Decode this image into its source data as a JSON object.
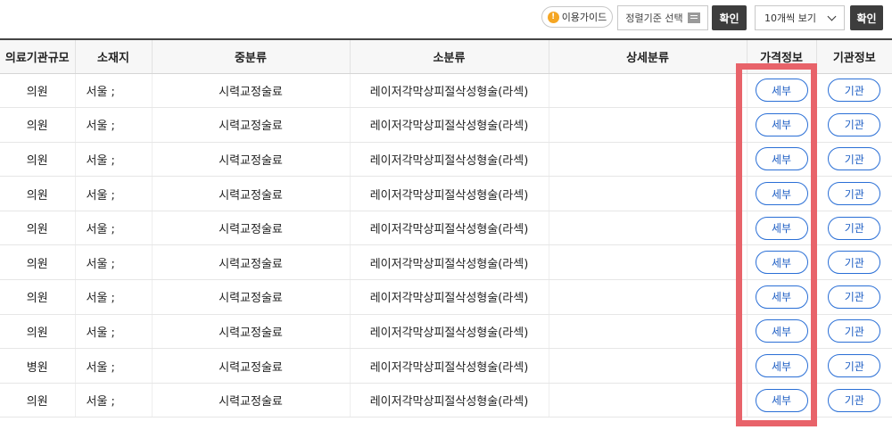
{
  "toolbar": {
    "guide_label": "이용가이드",
    "guide_icon": "exclamation-icon",
    "sort_label": "정렬기준 선택",
    "sort_icon": "list-icon",
    "confirm_label": "확인",
    "per_page_value": "10개씩 보기",
    "confirm2_label": "확인"
  },
  "table": {
    "headers": [
      "의료기관규모",
      "소재지",
      "중분류",
      "소분류",
      "상세분류",
      "가격정보",
      "기관정보"
    ],
    "rows": [
      {
        "size": "의원",
        "location": "서울 ;",
        "mid": "시력교정술료",
        "sub": "레이저각막상피절삭성형술(라섹)",
        "detail": "",
        "price_btn": "세부",
        "org_btn": "기관"
      },
      {
        "size": "의원",
        "location": "서울 ;",
        "mid": "시력교정술료",
        "sub": "레이저각막상피절삭성형술(라섹)",
        "detail": "",
        "price_btn": "세부",
        "org_btn": "기관"
      },
      {
        "size": "의원",
        "location": "서울 ;",
        "mid": "시력교정술료",
        "sub": "레이저각막상피절삭성형술(라섹)",
        "detail": "",
        "price_btn": "세부",
        "org_btn": "기관"
      },
      {
        "size": "의원",
        "location": "서울 ;",
        "mid": "시력교정술료",
        "sub": "레이저각막상피절삭성형술(라섹)",
        "detail": "",
        "price_btn": "세부",
        "org_btn": "기관"
      },
      {
        "size": "의원",
        "location": "서울 ;",
        "mid": "시력교정술료",
        "sub": "레이저각막상피절삭성형술(라섹)",
        "detail": "",
        "price_btn": "세부",
        "org_btn": "기관"
      },
      {
        "size": "의원",
        "location": "서울 ;",
        "mid": "시력교정술료",
        "sub": "레이저각막상피절삭성형술(라섹)",
        "detail": "",
        "price_btn": "세부",
        "org_btn": "기관"
      },
      {
        "size": "의원",
        "location": "서울 ;",
        "mid": "시력교정술료",
        "sub": "레이저각막상피절삭성형술(라섹)",
        "detail": "",
        "price_btn": "세부",
        "org_btn": "기관"
      },
      {
        "size": "의원",
        "location": "서울 ;",
        "mid": "시력교정술료",
        "sub": "레이저각막상피절삭성형술(라섹)",
        "detail": "",
        "price_btn": "세부",
        "org_btn": "기관"
      },
      {
        "size": "병원",
        "location": "서울 ;",
        "mid": "시력교정술료",
        "sub": "레이저각막상피절삭성형술(라섹)",
        "detail": "",
        "price_btn": "세부",
        "org_btn": "기관"
      },
      {
        "size": "의원",
        "location": "서울 ;",
        "mid": "시력교정술료",
        "sub": "레이저각막상피절삭성형술(라섹)",
        "detail": "",
        "price_btn": "세부",
        "org_btn": "기관"
      }
    ]
  },
  "colors": {
    "accent": "#2a6fd6",
    "highlight": "#e8636a",
    "dark_button": "#3d3d3d"
  }
}
